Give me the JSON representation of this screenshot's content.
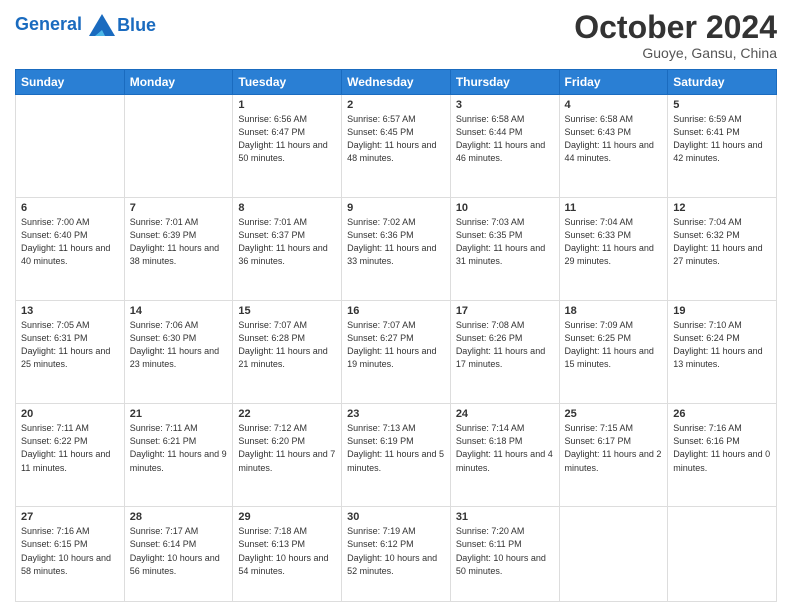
{
  "header": {
    "logo_line1": "General",
    "logo_line2": "Blue",
    "month": "October 2024",
    "location": "Guoye, Gansu, China"
  },
  "weekdays": [
    "Sunday",
    "Monday",
    "Tuesday",
    "Wednesday",
    "Thursday",
    "Friday",
    "Saturday"
  ],
  "weeks": [
    [
      {
        "day": "",
        "info": ""
      },
      {
        "day": "",
        "info": ""
      },
      {
        "day": "1",
        "info": "Sunrise: 6:56 AM\nSunset: 6:47 PM\nDaylight: 11 hours and 50 minutes."
      },
      {
        "day": "2",
        "info": "Sunrise: 6:57 AM\nSunset: 6:45 PM\nDaylight: 11 hours and 48 minutes."
      },
      {
        "day": "3",
        "info": "Sunrise: 6:58 AM\nSunset: 6:44 PM\nDaylight: 11 hours and 46 minutes."
      },
      {
        "day": "4",
        "info": "Sunrise: 6:58 AM\nSunset: 6:43 PM\nDaylight: 11 hours and 44 minutes."
      },
      {
        "day": "5",
        "info": "Sunrise: 6:59 AM\nSunset: 6:41 PM\nDaylight: 11 hours and 42 minutes."
      }
    ],
    [
      {
        "day": "6",
        "info": "Sunrise: 7:00 AM\nSunset: 6:40 PM\nDaylight: 11 hours and 40 minutes."
      },
      {
        "day": "7",
        "info": "Sunrise: 7:01 AM\nSunset: 6:39 PM\nDaylight: 11 hours and 38 minutes."
      },
      {
        "day": "8",
        "info": "Sunrise: 7:01 AM\nSunset: 6:37 PM\nDaylight: 11 hours and 36 minutes."
      },
      {
        "day": "9",
        "info": "Sunrise: 7:02 AM\nSunset: 6:36 PM\nDaylight: 11 hours and 33 minutes."
      },
      {
        "day": "10",
        "info": "Sunrise: 7:03 AM\nSunset: 6:35 PM\nDaylight: 11 hours and 31 minutes."
      },
      {
        "day": "11",
        "info": "Sunrise: 7:04 AM\nSunset: 6:33 PM\nDaylight: 11 hours and 29 minutes."
      },
      {
        "day": "12",
        "info": "Sunrise: 7:04 AM\nSunset: 6:32 PM\nDaylight: 11 hours and 27 minutes."
      }
    ],
    [
      {
        "day": "13",
        "info": "Sunrise: 7:05 AM\nSunset: 6:31 PM\nDaylight: 11 hours and 25 minutes."
      },
      {
        "day": "14",
        "info": "Sunrise: 7:06 AM\nSunset: 6:30 PM\nDaylight: 11 hours and 23 minutes."
      },
      {
        "day": "15",
        "info": "Sunrise: 7:07 AM\nSunset: 6:28 PM\nDaylight: 11 hours and 21 minutes."
      },
      {
        "day": "16",
        "info": "Sunrise: 7:07 AM\nSunset: 6:27 PM\nDaylight: 11 hours and 19 minutes."
      },
      {
        "day": "17",
        "info": "Sunrise: 7:08 AM\nSunset: 6:26 PM\nDaylight: 11 hours and 17 minutes."
      },
      {
        "day": "18",
        "info": "Sunrise: 7:09 AM\nSunset: 6:25 PM\nDaylight: 11 hours and 15 minutes."
      },
      {
        "day": "19",
        "info": "Sunrise: 7:10 AM\nSunset: 6:24 PM\nDaylight: 11 hours and 13 minutes."
      }
    ],
    [
      {
        "day": "20",
        "info": "Sunrise: 7:11 AM\nSunset: 6:22 PM\nDaylight: 11 hours and 11 minutes."
      },
      {
        "day": "21",
        "info": "Sunrise: 7:11 AM\nSunset: 6:21 PM\nDaylight: 11 hours and 9 minutes."
      },
      {
        "day": "22",
        "info": "Sunrise: 7:12 AM\nSunset: 6:20 PM\nDaylight: 11 hours and 7 minutes."
      },
      {
        "day": "23",
        "info": "Sunrise: 7:13 AM\nSunset: 6:19 PM\nDaylight: 11 hours and 5 minutes."
      },
      {
        "day": "24",
        "info": "Sunrise: 7:14 AM\nSunset: 6:18 PM\nDaylight: 11 hours and 4 minutes."
      },
      {
        "day": "25",
        "info": "Sunrise: 7:15 AM\nSunset: 6:17 PM\nDaylight: 11 hours and 2 minutes."
      },
      {
        "day": "26",
        "info": "Sunrise: 7:16 AM\nSunset: 6:16 PM\nDaylight: 11 hours and 0 minutes."
      }
    ],
    [
      {
        "day": "27",
        "info": "Sunrise: 7:16 AM\nSunset: 6:15 PM\nDaylight: 10 hours and 58 minutes."
      },
      {
        "day": "28",
        "info": "Sunrise: 7:17 AM\nSunset: 6:14 PM\nDaylight: 10 hours and 56 minutes."
      },
      {
        "day": "29",
        "info": "Sunrise: 7:18 AM\nSunset: 6:13 PM\nDaylight: 10 hours and 54 minutes."
      },
      {
        "day": "30",
        "info": "Sunrise: 7:19 AM\nSunset: 6:12 PM\nDaylight: 10 hours and 52 minutes."
      },
      {
        "day": "31",
        "info": "Sunrise: 7:20 AM\nSunset: 6:11 PM\nDaylight: 10 hours and 50 minutes."
      },
      {
        "day": "",
        "info": ""
      },
      {
        "day": "",
        "info": ""
      }
    ]
  ]
}
